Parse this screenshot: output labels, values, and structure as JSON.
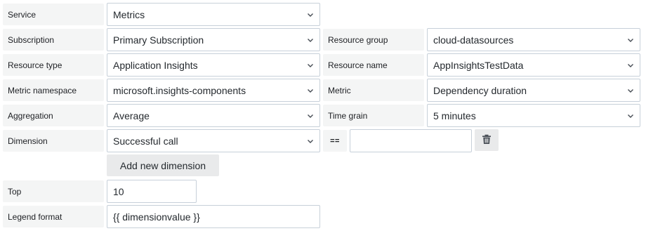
{
  "labels": {
    "service": "Service",
    "subscription": "Subscription",
    "resource_group": "Resource group",
    "resource_type": "Resource type",
    "resource_name": "Resource name",
    "metric_namespace": "Metric namespace",
    "metric": "Metric",
    "aggregation": "Aggregation",
    "time_grain": "Time grain",
    "dimension": "Dimension",
    "operator": "==",
    "top": "Top",
    "legend_format": "Legend format"
  },
  "values": {
    "service": "Metrics",
    "subscription": "Primary Subscription",
    "resource_group": "cloud-datasources",
    "resource_type": "Application Insights",
    "resource_name": "AppInsightsTestData",
    "metric_namespace": "microsoft.insights-components",
    "metric": "Dependency duration",
    "aggregation": "Average",
    "time_grain": "5 minutes",
    "dimension": "Successful call",
    "dimension_filter": "",
    "top": "10",
    "legend_format": "{{ dimensionvalue }}"
  },
  "buttons": {
    "add_dimension": "Add new dimension"
  },
  "icons": {
    "dropdown": "chevron-down-icon",
    "delete": "trash-icon"
  }
}
